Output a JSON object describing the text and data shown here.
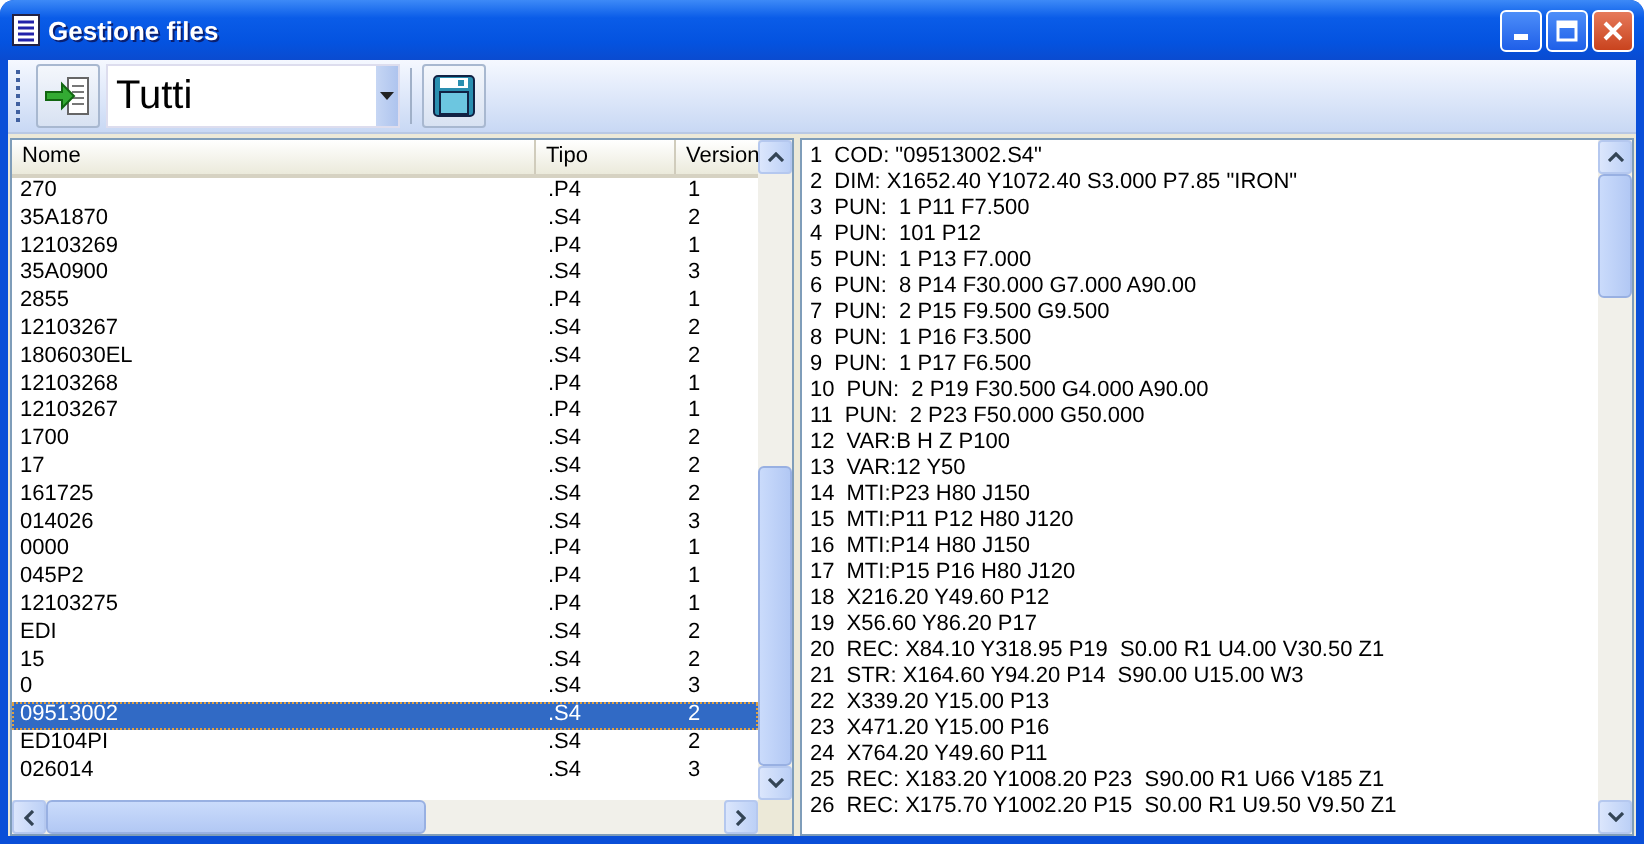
{
  "window": {
    "title": "Gestione files"
  },
  "toolbar": {
    "filter": "Tutti"
  },
  "table": {
    "columns": [
      "Nome",
      "Tipo",
      "Version"
    ],
    "rows": [
      {
        "cells": [
          "270",
          ".P4",
          "1"
        ],
        "selected": false
      },
      {
        "cells": [
          "35A1870",
          ".S4",
          "2"
        ],
        "selected": false
      },
      {
        "cells": [
          "12103269",
          ".P4",
          "1"
        ],
        "selected": false
      },
      {
        "cells": [
          "35A0900",
          ".S4",
          "3"
        ],
        "selected": false
      },
      {
        "cells": [
          "2855",
          ".P4",
          "1"
        ],
        "selected": false
      },
      {
        "cells": [
          "12103267",
          ".S4",
          "2"
        ],
        "selected": false
      },
      {
        "cells": [
          "1806030EL",
          ".S4",
          "2"
        ],
        "selected": false
      },
      {
        "cells": [
          "12103268",
          ".P4",
          "1"
        ],
        "selected": false
      },
      {
        "cells": [
          "12103267",
          ".P4",
          "1"
        ],
        "selected": false
      },
      {
        "cells": [
          "1700",
          ".S4",
          "2"
        ],
        "selected": false
      },
      {
        "cells": [
          "17",
          ".S4",
          "2"
        ],
        "selected": false
      },
      {
        "cells": [
          "161725",
          ".S4",
          "2"
        ],
        "selected": false
      },
      {
        "cells": [
          "014026",
          ".S4",
          "3"
        ],
        "selected": false
      },
      {
        "cells": [
          "0000",
          ".P4",
          "1"
        ],
        "selected": false
      },
      {
        "cells": [
          "045P2",
          ".P4",
          "1"
        ],
        "selected": false
      },
      {
        "cells": [
          "12103275",
          ".P4",
          "1"
        ],
        "selected": false
      },
      {
        "cells": [
          "EDI",
          ".S4",
          "2"
        ],
        "selected": false
      },
      {
        "cells": [
          "15",
          ".S4",
          "2"
        ],
        "selected": false
      },
      {
        "cells": [
          "0",
          ".S4",
          "3"
        ],
        "selected": false
      },
      {
        "cells": [
          "09513002",
          ".S4",
          "2"
        ],
        "selected": true
      },
      {
        "cells": [
          "ED104PI",
          ".S4",
          "2"
        ],
        "selected": false
      },
      {
        "cells": [
          "026014",
          ".S4",
          "3"
        ],
        "selected": false
      }
    ]
  },
  "code_lines": [
    {
      "num": "1",
      "text": "COD: \"09513002.S4\""
    },
    {
      "num": "2",
      "text": "DIM: X1652.40 Y1072.40 S3.000 P7.85 \"IRON\""
    },
    {
      "num": "3",
      "text": "PUN:  1 P11 F7.500"
    },
    {
      "num": "4",
      "text": "PUN:  101 P12"
    },
    {
      "num": "5",
      "text": "PUN:  1 P13 F7.000"
    },
    {
      "num": "6",
      "text": "PUN:  8 P14 F30.000 G7.000 A90.00"
    },
    {
      "num": "7",
      "text": "PUN:  2 P15 F9.500 G9.500"
    },
    {
      "num": "8",
      "text": "PUN:  1 P16 F3.500"
    },
    {
      "num": "9",
      "text": "PUN:  1 P17 F6.500"
    },
    {
      "num": "10",
      "text": "PUN:  2 P19 F30.500 G4.000 A90.00"
    },
    {
      "num": "11",
      "text": "PUN:  2 P23 F50.000 G50.000"
    },
    {
      "num": "12",
      "text": "VAR:B H Z P100"
    },
    {
      "num": "13",
      "text": "VAR:12 Y50"
    },
    {
      "num": "14",
      "text": "MTI:P23 H80 J150"
    },
    {
      "num": "15",
      "text": "MTI:P11 P12 H80 J120"
    },
    {
      "num": "16",
      "text": "MTI:P14 H80 J150"
    },
    {
      "num": "17",
      "text": "MTI:P15 P16 H80 J120"
    },
    {
      "num": "18",
      "text": "X216.20 Y49.60 P12"
    },
    {
      "num": "19",
      "text": "X56.60 Y86.20 P17"
    },
    {
      "num": "20",
      "text": "REC: X84.10 Y318.95 P19  S0.00 R1 U4.00 V30.50 Z1"
    },
    {
      "num": "21",
      "text": "STR: X164.60 Y94.20 P14  S90.00 U15.00 W3"
    },
    {
      "num": "22",
      "text": "X339.20 Y15.00 P13"
    },
    {
      "num": "23",
      "text": "X471.20 Y15.00 P16"
    },
    {
      "num": "24",
      "text": "X764.20 Y49.60 P11"
    },
    {
      "num": "25",
      "text": "REC: X183.20 Y1008.20 P23  S90.00 R1 U66 V185 Z1"
    },
    {
      "num": "26",
      "text": "REC: X175.70 Y1002.20 P15  S0.00 R1 U9.50 V9.50 Z1"
    }
  ]
}
